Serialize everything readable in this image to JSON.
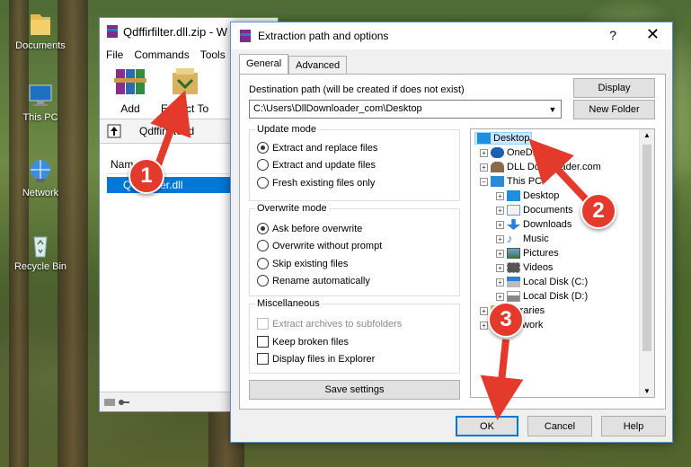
{
  "desktop": {
    "icons": [
      {
        "label": "Documents"
      },
      {
        "label": "This PC"
      },
      {
        "label": "Network"
      },
      {
        "label": "Recycle Bin"
      }
    ]
  },
  "rar": {
    "title": "Qdffirfilter.dll.zip - W",
    "menu": [
      "File",
      "Commands",
      "Tools"
    ],
    "toolbar": {
      "add": "Add",
      "extract": "Extract To"
    },
    "path": "Qdffirfilter.d",
    "column_name": "Name",
    "file": "Qdffirfilter.dll"
  },
  "dialog": {
    "title": "Extraction path and options",
    "help_glyph": "?",
    "close_glyph": "✕",
    "tabs": [
      "General",
      "Advanced"
    ],
    "dest_label": "Destination path (will be created if does not exist)",
    "dest_value": "C:\\Users\\DllDownloader_com\\Desktop",
    "display_btn": "Display",
    "new_folder_btn": "New Folder",
    "update_mode": {
      "title": "Update mode",
      "options": [
        "Extract and replace files",
        "Extract and update files",
        "Fresh existing files only"
      ],
      "selected": 0
    },
    "overwrite_mode": {
      "title": "Overwrite mode",
      "options": [
        "Ask before overwrite",
        "Overwrite without prompt",
        "Skip existing files",
        "Rename automatically"
      ],
      "selected": 0
    },
    "misc": {
      "title": "Miscellaneous",
      "options": [
        "Extract archives to subfolders",
        "Keep broken files",
        "Display files in Explorer"
      ]
    },
    "save_btn": "Save settings",
    "tree": {
      "desktop": "Desktop",
      "onedrive": "OneDrive",
      "dlldownloader": "DLL Downloader.com",
      "thispc": "This PC",
      "children": [
        "Desktop",
        "Documents",
        "Downloads",
        "Music",
        "Pictures",
        "Videos",
        "Local Disk (C:)",
        "Local Disk (D:)"
      ],
      "libraries": "Libraries",
      "network": "Network"
    },
    "ok": "OK",
    "cancel": "Cancel",
    "help": "Help"
  },
  "markers": [
    "1",
    "2",
    "3"
  ],
  "colors": {
    "marker": "#e33a2c",
    "accent": "#0078d7"
  }
}
